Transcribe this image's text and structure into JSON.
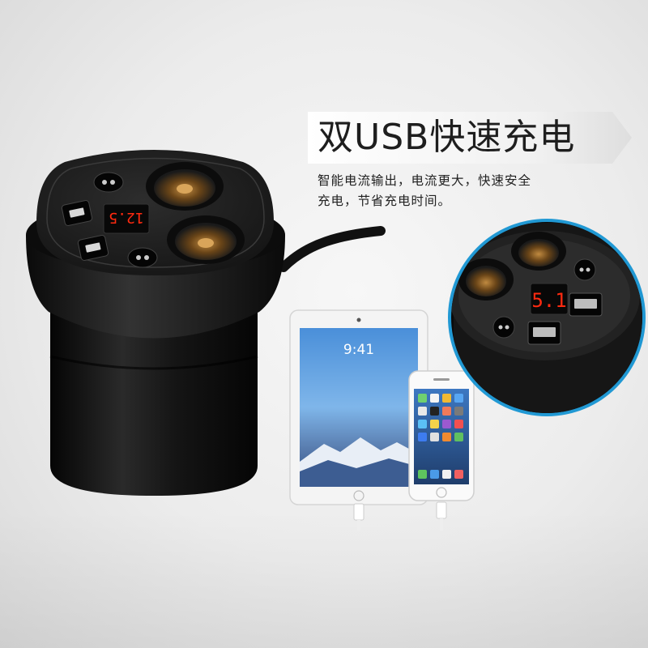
{
  "headline": "双USB快速充电",
  "description_lines": [
    "智能电流输出，电流更大，快速安全",
    "充电，节省充电时间。"
  ],
  "charger_display": "12.5",
  "inset_display": "5.1",
  "tablet_time": "9:41",
  "colors": {
    "charger_body": "#1a1a1a",
    "led_red": "#ff2a10",
    "socket_glow": "#9a6a2a",
    "inset_ring": "#0a8fd0"
  },
  "icons": [
    "usb-port-icon",
    "cigarette-socket-icon",
    "power-button-icon",
    "lightning-cable-icon"
  ]
}
